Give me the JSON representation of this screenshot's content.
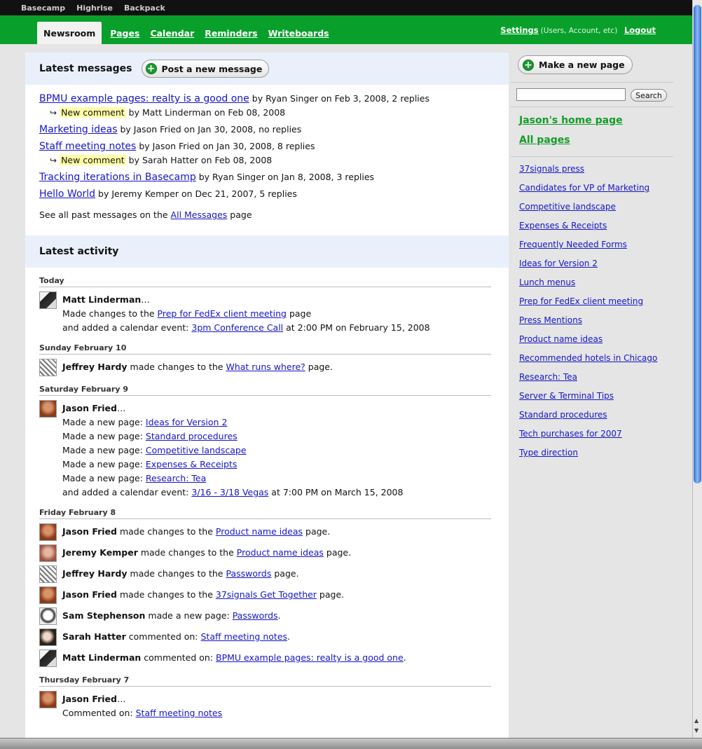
{
  "topbar": {
    "links": [
      "Basecamp",
      "Highrise",
      "Backpack"
    ]
  },
  "nav": {
    "tabs": [
      "Newsroom",
      "Pages",
      "Calendar",
      "Reminders",
      "Writeboards"
    ],
    "settings_label": "Settings",
    "settings_note": "(Users, Account, etc)",
    "logout_label": "Logout"
  },
  "messages": {
    "heading": "Latest messages",
    "post_button": "Post a new message",
    "items": [
      {
        "title": "BPMU example pages: realty is a good one",
        "meta": " by Ryan Singer on Feb 3, 2008, 2 replies",
        "comment": {
          "label": "New comment",
          "meta": " by Matt Linderman on Feb 08, 2008"
        }
      },
      {
        "title": "Marketing ideas",
        "meta": " by Jason Fried on Jan 30, 2008, no replies"
      },
      {
        "title": "Staff meeting notes",
        "meta": " by Jason Fried on Jan 30, 2008, 8 replies",
        "comment": {
          "label": "New comment",
          "meta": " by Sarah Hatter on Feb 08, 2008"
        }
      },
      {
        "title": "Tracking iterations in Basecamp",
        "meta": " by Ryan Singer on Jan 8, 2008, 3 replies"
      },
      {
        "title": "Hello World",
        "meta": " by Jeremy Kemper on Dec 21, 2007, 5 replies"
      }
    ],
    "past_prefix": "See all past messages on the ",
    "past_link": "All Messages",
    "past_suffix": " page"
  },
  "activity": {
    "heading": "Latest activity",
    "days": [
      {
        "label": "Today",
        "entries": [
          {
            "who": "Matt Linderman",
            "lines": [
              {
                "pre": "Made changes to the ",
                "link": "Prep for FedEx client meeting",
                "post": " page"
              },
              {
                "pre": "and added a calendar event: ",
                "link": "3pm Conference Call",
                "post": " at 2:00 PM on February 15, 2008"
              }
            ]
          }
        ]
      },
      {
        "label": "Sunday February 10",
        "entries": [
          {
            "who": "Jeffrey Hardy",
            "pre": " made changes to the ",
            "link": "What runs where?",
            "post": " page."
          }
        ]
      },
      {
        "label": "Saturday February 9",
        "entries": [
          {
            "who": "Jason Fried",
            "lines": [
              {
                "pre": "Made a new page: ",
                "link": "Ideas for Version 2",
                "post": ""
              },
              {
                "pre": "Made a new page: ",
                "link": "Standard procedures",
                "post": ""
              },
              {
                "pre": "Made a new page: ",
                "link": "Competitive landscape",
                "post": ""
              },
              {
                "pre": "Made a new page: ",
                "link": "Expenses & Receipts",
                "post": ""
              },
              {
                "pre": "Made a new page: ",
                "link": "Research: Tea",
                "post": ""
              },
              {
                "pre": "and added a calendar event: ",
                "link": "3/16 - 3/18 Vegas",
                "post": " at 7:00 PM on March 15, 2008"
              }
            ]
          }
        ]
      },
      {
        "label": "Friday February 8",
        "entries": [
          {
            "who": "Jason Fried",
            "pre": " made changes to the ",
            "link": "Product name ideas",
            "post": " page."
          },
          {
            "who": "Jeremy Kemper",
            "pre": " made changes to the ",
            "link": "Product name ideas",
            "post": " page."
          },
          {
            "who": "Jeffrey Hardy",
            "pre": " made changes to the ",
            "link": "Passwords",
            "post": " page."
          },
          {
            "who": "Jason Fried",
            "pre": " made changes to the ",
            "link": "37signals Get Together",
            "post": " page."
          },
          {
            "who": "Sam Stephenson",
            "pre": " made a new page: ",
            "link": "Passwords",
            "post": "."
          },
          {
            "who": "Sarah Hatter",
            "pre": " commented on: ",
            "link": "Staff meeting notes",
            "post": "."
          },
          {
            "who": "Matt Linderman",
            "pre": " commented on: ",
            "link": "BPMU example pages: realty is a good one",
            "post": "."
          }
        ]
      },
      {
        "label": "Thursday February 7",
        "entries": [
          {
            "who": "Jason Fried",
            "lines": [
              {
                "pre": "Commented on: ",
                "link": "Staff meeting notes",
                "post": ""
              }
            ]
          }
        ]
      }
    ]
  },
  "sidebar": {
    "new_page_button": "Make a new page",
    "search_button": "Search",
    "search_value": "",
    "home_link": "Jason's home page",
    "all_pages_link": "All pages",
    "pages": [
      "37signals press",
      "Candidates for VP of Marketing",
      "Competitive landscape",
      "Expenses & Receipts",
      "Frequently Needed Forms",
      "Ideas for Version 2",
      "Lunch menus",
      "Prep for FedEx client meeting",
      "Press Mentions",
      "Product name ideas",
      "Recommended hotels in Chicago",
      "Research: Tea",
      "Server & Terminal Tips",
      "Standard procedures",
      "Tech purchases for 2007",
      "Type direction"
    ]
  },
  "colors": {
    "green_bar": "#08a02a",
    "link": "#1515c8",
    "highlight": "#ffffa8",
    "section_bg": "#eaf0fb"
  }
}
